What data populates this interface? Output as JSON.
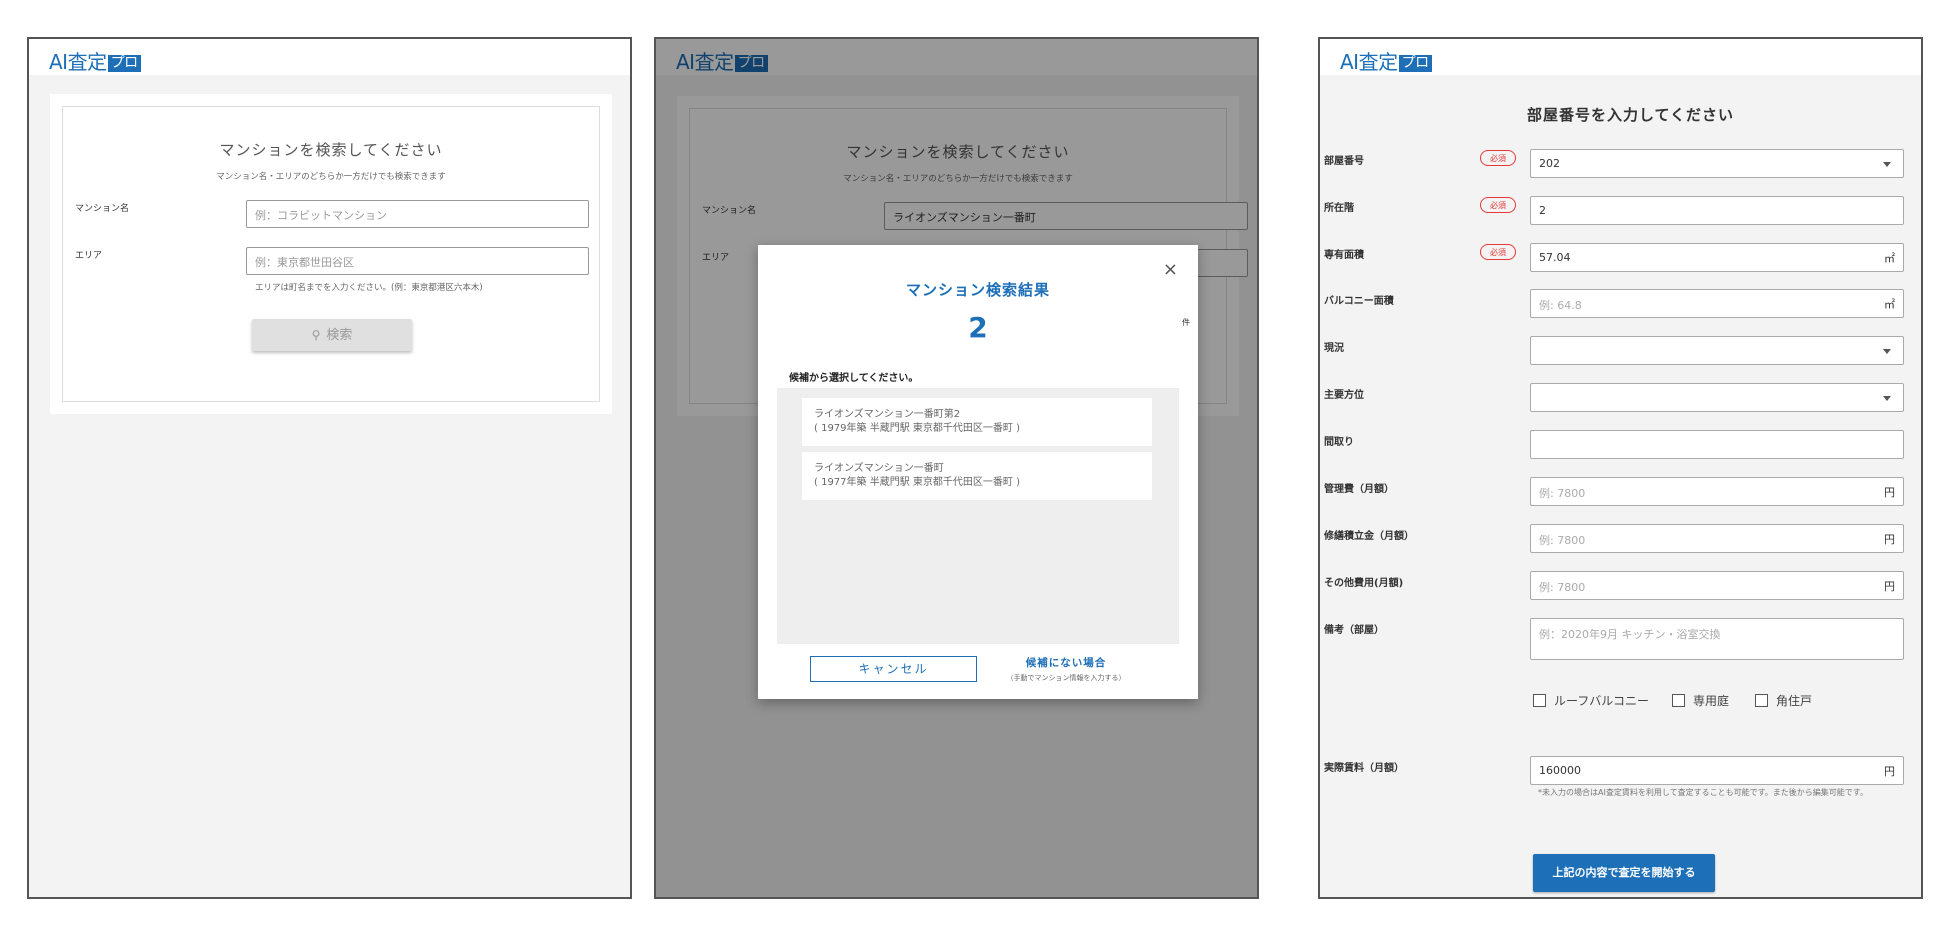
{
  "logo": {
    "main": "AI査定",
    "pro": "プロ"
  },
  "search": {
    "title": "マンションを検索してください",
    "subtitle": "マンション名・エリアのどちらか一方だけでも検索できます",
    "name_label": "マンション名",
    "name_placeholder": "例：コラビットマンション",
    "name_value": "ライオンズマンション一番町",
    "area_label": "エリア",
    "area_placeholder": "例：東京都世田谷区",
    "area_hint": "エリアは町名までを入力ください。(例：東京都港区六本木)",
    "search_button": "検索"
  },
  "modal": {
    "close": "×",
    "title": "マンション検索結果",
    "count": "2",
    "count_unit": "件",
    "prompt": "候補から選択してください。",
    "results": [
      {
        "line1": "ライオンズマンション一番町第2",
        "line2": "( 1979年築 半蔵門駅 東京都千代田区一番町 )"
      },
      {
        "line1": "ライオンズマンション一番町",
        "line2": "( 1977年築 半蔵門駅 東京都千代田区一番町 )"
      }
    ],
    "cancel": "キャンセル",
    "no_candidate": "候補にない場合",
    "no_candidate_sub": "（手動でマンション情報を入力する）"
  },
  "room": {
    "title": "部屋番号を入力してください",
    "required": "必須",
    "fields": [
      {
        "label": "部屋番号",
        "value": "202",
        "placeholder": ""
      },
      {
        "label": "所在階",
        "value": "2",
        "placeholder": ""
      },
      {
        "label": "専有面積",
        "value": "57.04",
        "placeholder": "",
        "unit": "㎡"
      },
      {
        "label": "バルコニー面積",
        "value": "",
        "placeholder": "例: 64.8",
        "unit": "㎡"
      },
      {
        "label": "現況",
        "value": "",
        "placeholder": ""
      },
      {
        "label": "主要方位",
        "value": "",
        "placeholder": ""
      },
      {
        "label": "間取り",
        "value": "",
        "placeholder": ""
      },
      {
        "label": "管理費（月額）",
        "value": "",
        "placeholder": "例: 7800",
        "unit": "円"
      },
      {
        "label": "修繕積立金（月額）",
        "value": "",
        "placeholder": "例: 7800",
        "unit": "円"
      },
      {
        "label": "その他費用(月額)",
        "value": "",
        "placeholder": "例: 7800",
        "unit": "円"
      },
      {
        "label": "備考（部屋）",
        "value": "",
        "placeholder": "例：2020年9月 キッチン・浴室交換"
      }
    ],
    "checkboxes": [
      "ルーフバルコニー",
      "専用庭",
      "角住戸"
    ],
    "rent_label": "実際賃料（月額）",
    "rent_value": "160000",
    "rent_unit": "円",
    "note": "*未入力の場合はAI査定賃料を利用して査定することも可能です。また後から編集可能です。",
    "submit": "上記の内容で査定を開始する"
  }
}
